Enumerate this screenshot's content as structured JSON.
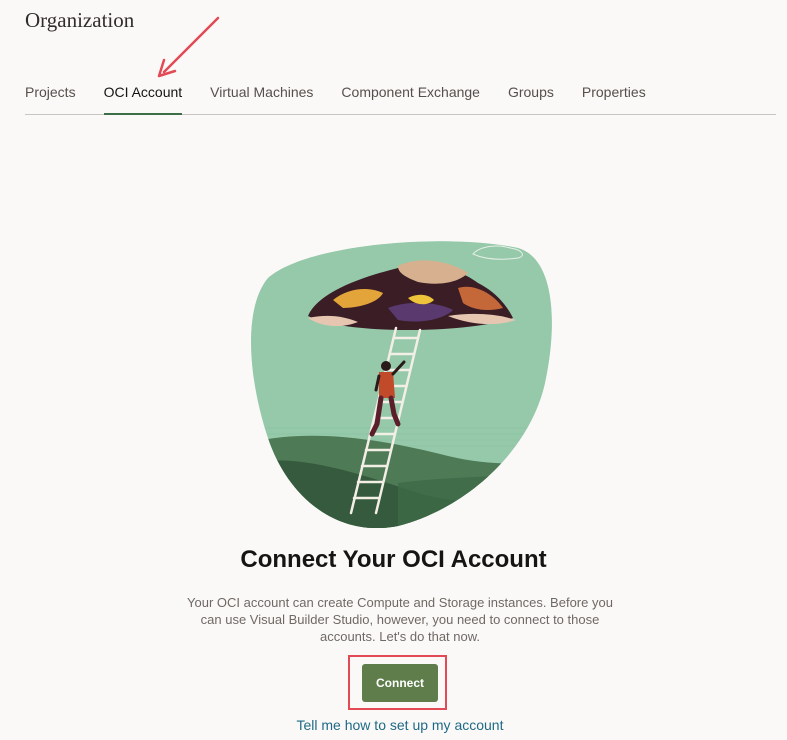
{
  "header": {
    "title": "Organization"
  },
  "tabs": [
    {
      "label": "Projects",
      "active": false
    },
    {
      "label": "OCI Account",
      "active": true
    },
    {
      "label": "Virtual Machines",
      "active": false
    },
    {
      "label": "Component Exchange",
      "active": false
    },
    {
      "label": "Groups",
      "active": false
    },
    {
      "label": "Properties",
      "active": false
    }
  ],
  "empty_state": {
    "illustration": "person-climbing-ladder-illustration",
    "heading": "Connect Your OCI Account",
    "description": "Your OCI account can create Compute and Storage instances. Before you can use Visual Builder Studio, however, you need to connect to those accounts. Let's do that now.",
    "connect_label": "Connect",
    "help_link": "Tell me how to set up my account"
  },
  "colors": {
    "accent": "#3c6e47",
    "button": "#5e7d4b",
    "link": "#1e6a86",
    "annotation": "#e24a55"
  }
}
